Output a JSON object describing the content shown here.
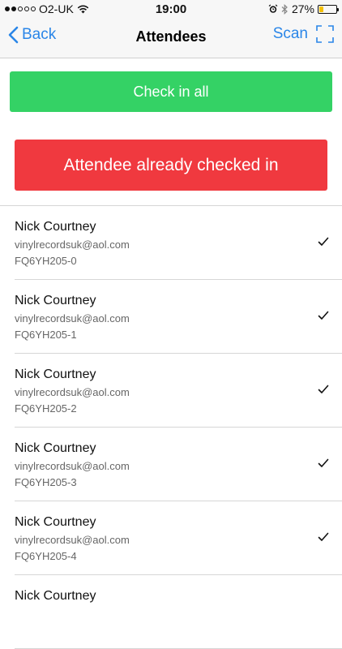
{
  "status_bar": {
    "carrier": "O2-UK",
    "time": "19:00",
    "battery_text": "27%",
    "battery_level": 0.27,
    "battery_color": "#f5c000"
  },
  "nav": {
    "back_label": "Back",
    "title": "Attendees",
    "scan_label": "Scan"
  },
  "actions": {
    "check_in_all_label": "Check in all",
    "check_in_color": "#34d265"
  },
  "alert": {
    "message": "Attendee already checked in",
    "color": "#f0393f"
  },
  "attendees": [
    {
      "name": "Nick Courtney",
      "email": "vinylrecordsuk@aol.com",
      "code": "FQ6YH205-0",
      "checked_in": true
    },
    {
      "name": "Nick Courtney",
      "email": "vinylrecordsuk@aol.com",
      "code": "FQ6YH205-1",
      "checked_in": true
    },
    {
      "name": "Nick Courtney",
      "email": "vinylrecordsuk@aol.com",
      "code": "FQ6YH205-2",
      "checked_in": true
    },
    {
      "name": "Nick Courtney",
      "email": "vinylrecordsuk@aol.com",
      "code": "FQ6YH205-3",
      "checked_in": true
    },
    {
      "name": "Nick Courtney",
      "email": "vinylrecordsuk@aol.com",
      "code": "FQ6YH205-4",
      "checked_in": true
    },
    {
      "name": "Nick Courtney",
      "email": "",
      "code": "",
      "checked_in": false
    }
  ],
  "icons": {
    "back": "chevron-left-icon",
    "scan": "scan-frame-icon",
    "check": "checkmark-icon",
    "wifi": "wifi-icon",
    "alarm": "alarm-icon",
    "bluetooth": "bluetooth-icon"
  },
  "accent_color": "#2a86e8"
}
